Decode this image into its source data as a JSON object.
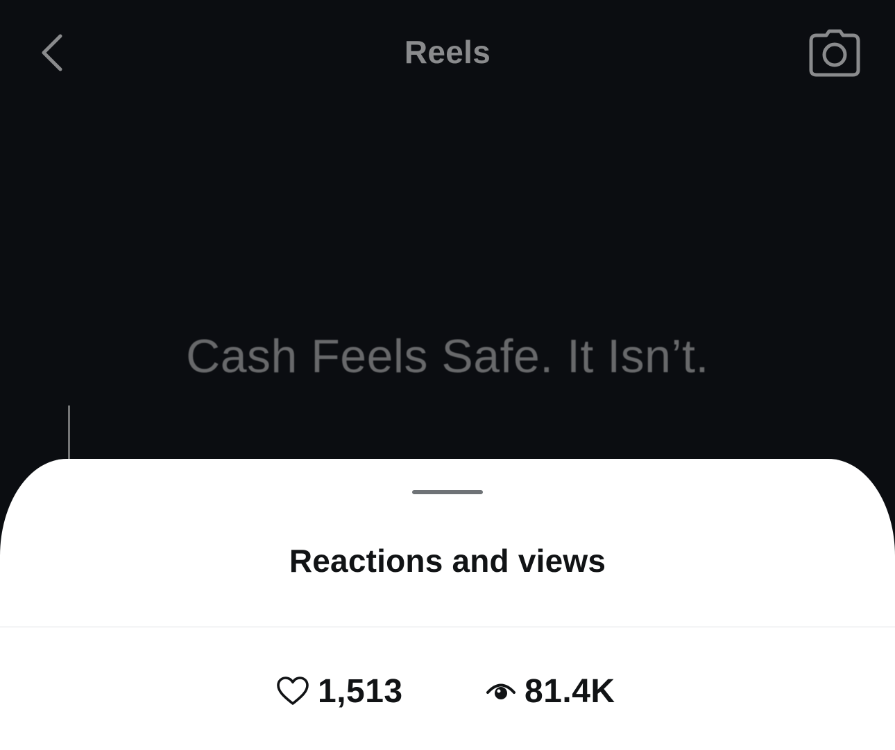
{
  "header": {
    "title": "Reels",
    "back_icon": "chevron-left-icon",
    "camera_icon": "camera-icon"
  },
  "video": {
    "caption": "Cash Feels Safe. It Isn’t."
  },
  "sheet": {
    "title": "Reactions and views",
    "stats": {
      "likes": {
        "icon": "heart-icon",
        "value": "1,513"
      },
      "views": {
        "icon": "eye-icon",
        "value": "81.4K"
      }
    }
  },
  "colors": {
    "background": "#0b0d11",
    "sheet": "#ffffff",
    "text_dark": "#111315",
    "header_text": "#8a8b8d"
  }
}
